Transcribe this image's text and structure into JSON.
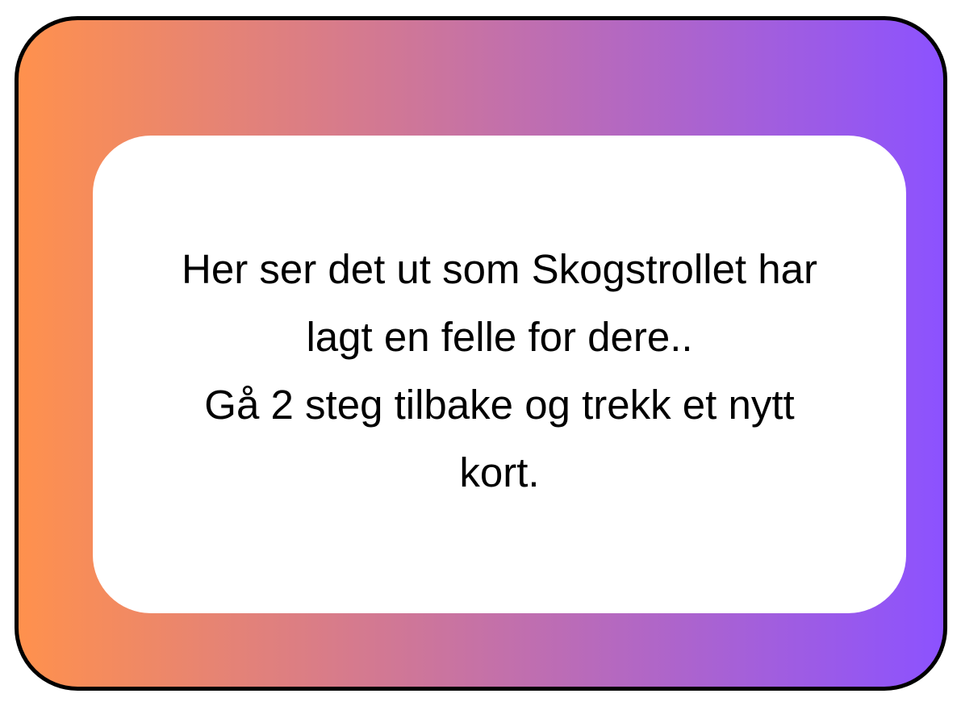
{
  "card": {
    "gradient": {
      "start": "#FF914D",
      "end": "#8C52FF"
    },
    "border_color": "#000000",
    "lines": [
      "Her ser det ut som Skogstrollet har",
      "lagt en felle for dere..",
      "Gå 2 steg tilbake og trekk et nytt",
      "kort."
    ]
  }
}
